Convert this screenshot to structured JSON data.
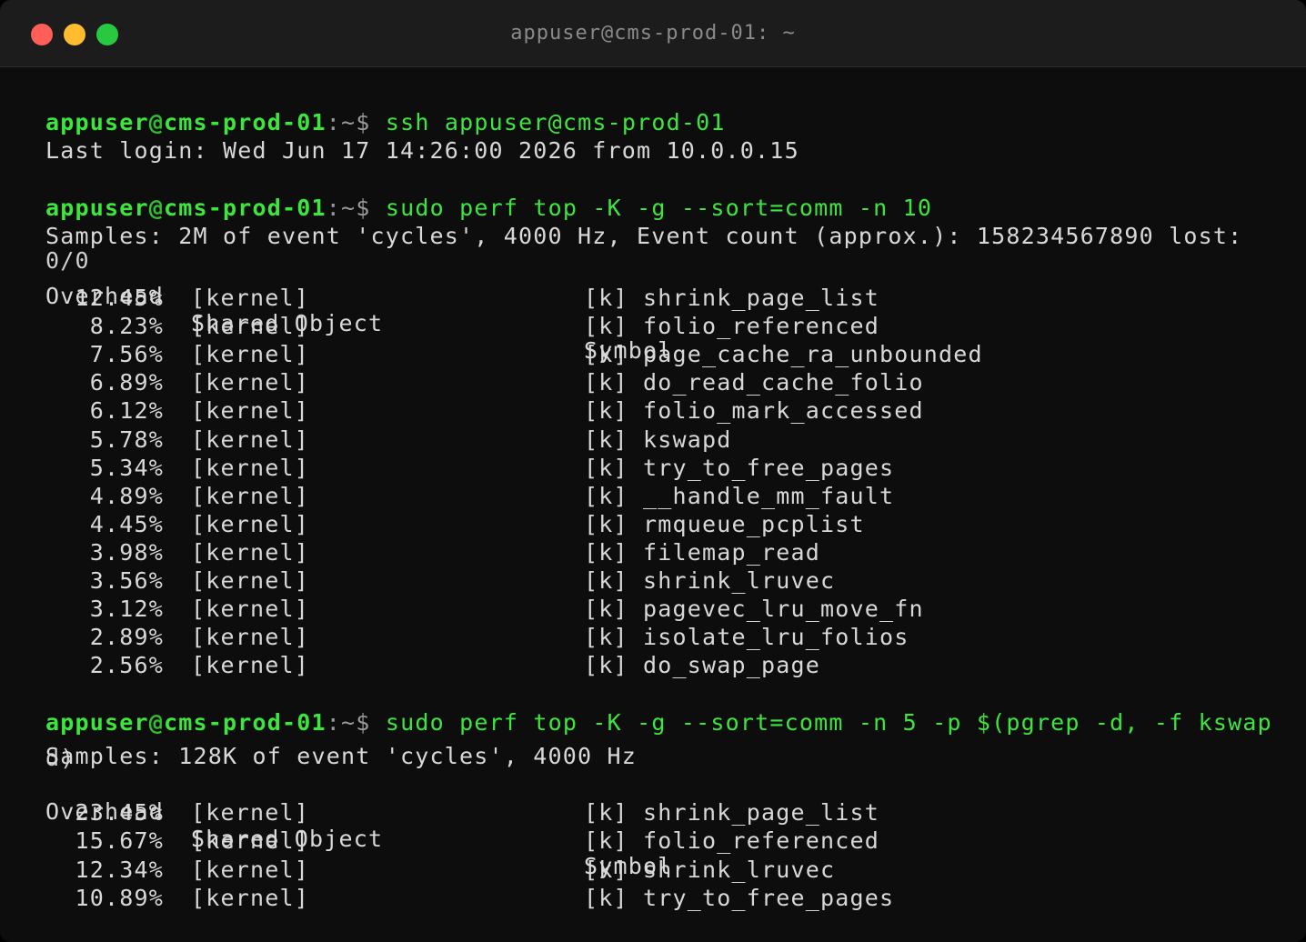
{
  "window": {
    "title": "appuser@cms-prod-01: ~"
  },
  "prompt": {
    "user": "appuser",
    "at": "@",
    "host": "cms-prod-01",
    "path": ":~$"
  },
  "session": {
    "cmd1": "ssh appuser@cms-prod-01",
    "login_line": "Last login: Wed Jun 17 14:26:00 2026 from 10.0.0.15",
    "cmd2": "sudo perf top -K -g --sort=comm -n 10",
    "samples1": "Samples: 2M of event 'cycles', 4000 Hz, Event count (approx.): 158234567890 lost:",
    "samples1_wrap": "0/0",
    "header_overhead": "Overhead",
    "header_object": "Shared Object",
    "header_symbol": "Symbol",
    "table1": [
      {
        "overhead": "12.45%",
        "object": "[kernel]",
        "symbol": "[k] shrink_page_list"
      },
      {
        "overhead": "8.23%",
        "object": "[kernel]",
        "symbol": "[k] folio_referenced"
      },
      {
        "overhead": "7.56%",
        "object": "[kernel]",
        "symbol": "[k] page_cache_ra_unbounded"
      },
      {
        "overhead": "6.89%",
        "object": "[kernel]",
        "symbol": "[k] do_read_cache_folio"
      },
      {
        "overhead": "6.12%",
        "object": "[kernel]",
        "symbol": "[k] folio_mark_accessed"
      },
      {
        "overhead": "5.78%",
        "object": "[kernel]",
        "symbol": "[k] kswapd"
      },
      {
        "overhead": "5.34%",
        "object": "[kernel]",
        "symbol": "[k] try_to_free_pages"
      },
      {
        "overhead": "4.89%",
        "object": "[kernel]",
        "symbol": "[k] __handle_mm_fault"
      },
      {
        "overhead": "4.45%",
        "object": "[kernel]",
        "symbol": "[k] rmqueue_pcplist"
      },
      {
        "overhead": "3.98%",
        "object": "[kernel]",
        "symbol": "[k] filemap_read"
      },
      {
        "overhead": "3.56%",
        "object": "[kernel]",
        "symbol": "[k] shrink_lruvec"
      },
      {
        "overhead": "3.12%",
        "object": "[kernel]",
        "symbol": "[k] pagevec_lru_move_fn"
      },
      {
        "overhead": "2.89%",
        "object": "[kernel]",
        "symbol": "[k] isolate_lru_folios"
      },
      {
        "overhead": "2.56%",
        "object": "[kernel]",
        "symbol": "[k] do_swap_page"
      }
    ],
    "cmd3": "sudo perf top -K -g --sort=comm -n 5 -p $(pgrep -d, -f kswap",
    "cmd3_wrap": "d)",
    "samples2": "Samples: 128K of event 'cycles', 4000 Hz",
    "table2": [
      {
        "overhead": "23.45%",
        "object": "[kernel]",
        "symbol": "[k] shrink_page_list"
      },
      {
        "overhead": "15.67%",
        "object": "[kernel]",
        "symbol": "[k] folio_referenced"
      },
      {
        "overhead": "12.34%",
        "object": "[kernel]",
        "symbol": "[k] shrink_lruvec"
      },
      {
        "overhead": "10.89%",
        "object": "[kernel]",
        "symbol": "[k] try_to_free_pages"
      }
    ]
  },
  "colors": {
    "prompt_green": "#3ce63c",
    "text": "#d8d8d8",
    "background": "#0d0d0d"
  }
}
